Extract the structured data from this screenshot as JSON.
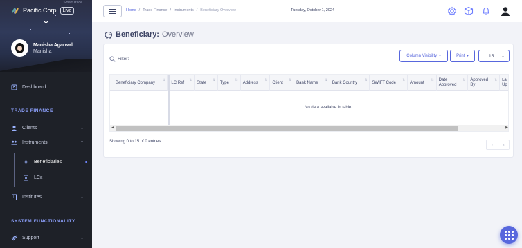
{
  "brand": {
    "name": "Pacific Corp",
    "badge": "Live",
    "sub": "Smart Trade"
  },
  "user": {
    "name": "Manisha Agarwal",
    "sub": "Manisha"
  },
  "sidebar": {
    "dashboard": "Dashboard",
    "section_trade": "TRADE FINANCE",
    "clients": "Clients",
    "instruments": "Instruments",
    "beneficiaries": "Beneficiaries",
    "lcs": "LCs",
    "institutes": "Institutes",
    "section_system": "SYSTEM FUNCTIONALITY",
    "support": "Support"
  },
  "header": {
    "breadcrumbs": [
      "Home",
      "Trade Finance",
      "Instruments",
      "Beneficiary Overview"
    ],
    "separator": "/",
    "date": "Tuesday, October 1, 2024"
  },
  "page": {
    "title": "Beneficiary:",
    "subtitle": "Overview"
  },
  "toolbar": {
    "filter_label": "Filter:",
    "column_visibility": "Column Visibility",
    "print": "Print",
    "page_length": "15"
  },
  "table": {
    "columns": [
      "Beneficiary Company",
      "LC Ref",
      "State",
      "Type",
      "Address",
      "Client",
      "Bank Name",
      "Bank Country",
      "SWIFT Code",
      "Amount",
      "Date Approved",
      "Approved By",
      "La... Up..."
    ],
    "empty_message": "No data available in table"
  },
  "footer": {
    "info": "Showing 0 to 15 of 0 entries",
    "prev": "‹",
    "next": "›"
  },
  "colors": {
    "accent": "#5867dd",
    "sidebar_bg": "#1e2128",
    "section_label": "#8ea2ff",
    "page_bg": "#f2f3f8"
  },
  "icons": [
    "menu-icon",
    "settings-icon",
    "box-icon",
    "bell-icon",
    "user-icon",
    "dashboard-icon",
    "clients-icon",
    "instruments-icon",
    "beneficiaries-icon",
    "lcs-icon",
    "institutes-icon",
    "support-icon",
    "piggy-bank-icon",
    "search-icon",
    "apps-grid-icon"
  ]
}
